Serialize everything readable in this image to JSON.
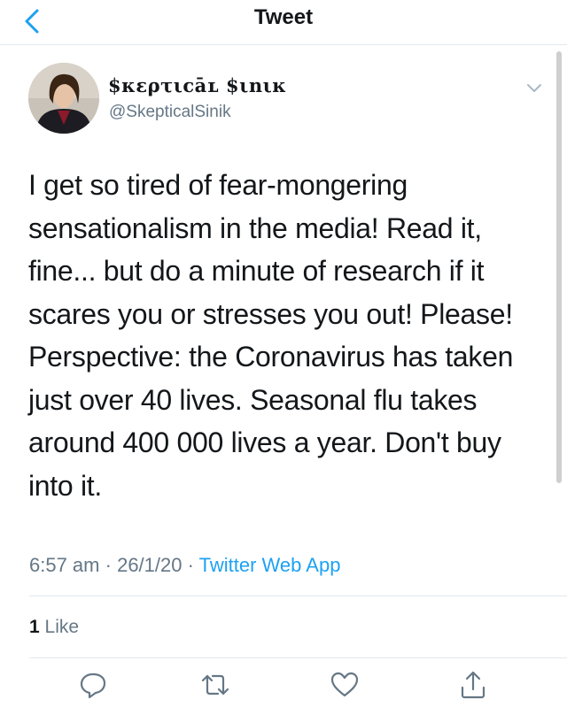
{
  "header": {
    "title": "Tweet",
    "back_icon": "chevron-left-icon"
  },
  "tweet": {
    "display_name": "$κερτιcāʟ $ιnιĸ",
    "handle": "@SkepticalSinik",
    "text": "I get so tired of fear-mongering\nsensationalism in the media! Read it,\nfine... but do a minute of research if it\nscares you or stresses you out! Please!\nPerspective: the Coronavirus has taken\njust over 40 lives. Seasonal flu takes\naround 400 000 lives a year. Don't buy\ninto it.",
    "time": "6:57 am",
    "date": "26/1/20",
    "separator": "·",
    "source": "Twitter Web App",
    "like_count": "1",
    "like_label": "Like"
  },
  "actions": [
    "reply-icon",
    "retweet-icon",
    "like-icon",
    "share-icon"
  ],
  "colors": {
    "accent": "#1da1f2",
    "muted": "#657786",
    "text": "#14171a",
    "divider": "#e1e8ed"
  }
}
